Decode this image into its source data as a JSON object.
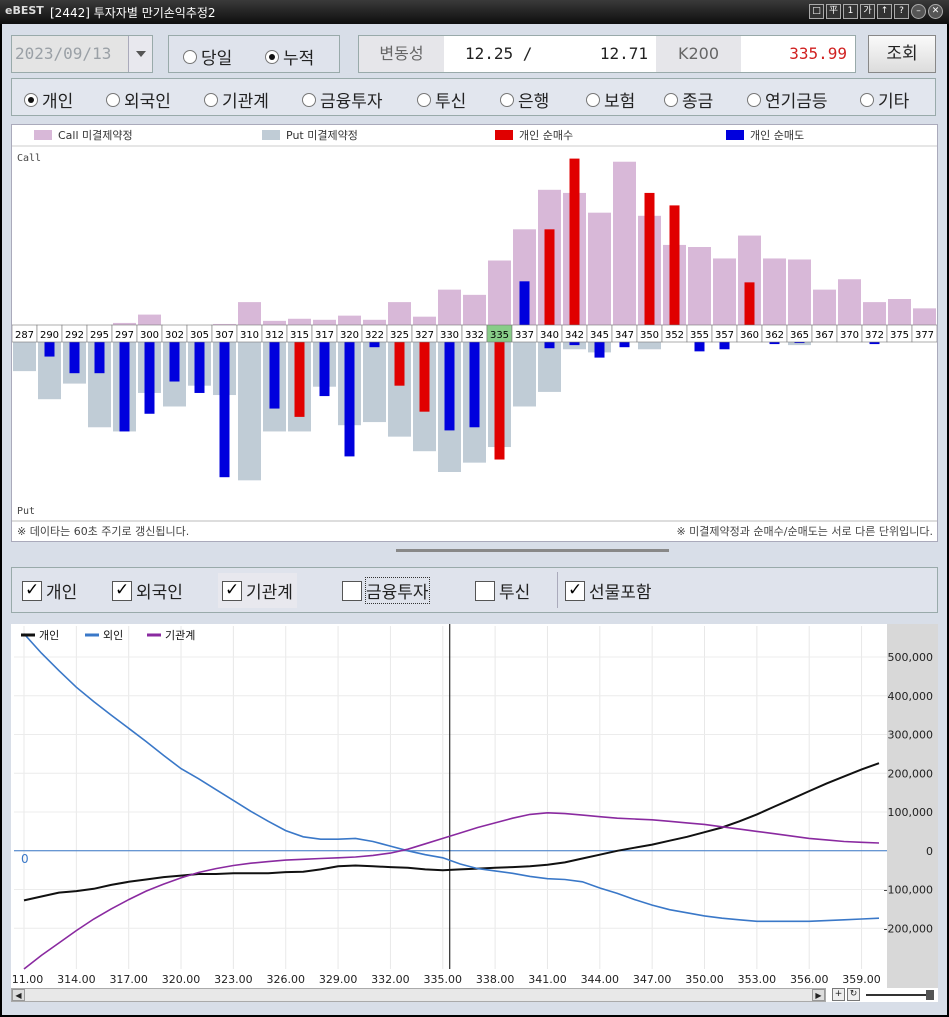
{
  "window": {
    "logo_text": "eBEST",
    "title": "[2442] 투자자별 만기손익추정2",
    "buttons": [
      "□",
      "平",
      "1",
      "가",
      "↑",
      "?",
      "–",
      "✕"
    ]
  },
  "controls": {
    "date": "2023/09/13",
    "mode_options": [
      {
        "label": "당일",
        "selected": false
      },
      {
        "label": "누적",
        "selected": true
      }
    ],
    "volatility_label": "변동성",
    "volatility_value": "12.25 /       12.71",
    "k200_label": "K200",
    "k200_value": "335.99",
    "query_button": "조회"
  },
  "investors": [
    {
      "label": "개인",
      "selected": true
    },
    {
      "label": "외국인",
      "selected": false
    },
    {
      "label": "기관계",
      "selected": false
    },
    {
      "label": "금융투자",
      "selected": false
    },
    {
      "label": "투신",
      "selected": false
    },
    {
      "label": "은행",
      "selected": false
    },
    {
      "label": "보험",
      "selected": false
    },
    {
      "label": "종금",
      "selected": false
    },
    {
      "label": "연기금등",
      "selected": false
    },
    {
      "label": "기타",
      "selected": false
    }
  ],
  "chart_data": [
    {
      "type": "bar",
      "legend": [
        "Call 미결제약정",
        "Put 미결제약정",
        "개인 순매수",
        "개인 순매도"
      ],
      "colors": {
        "call_oi": "#d8b8d8",
        "put_oi": "#c0ccd6",
        "buy": "#e00000",
        "sell": "#0000dd",
        "highlight": "#88cc88"
      },
      "call_label": "Call",
      "put_label": "Put",
      "strikes": [
        "287",
        "290",
        "292",
        "295",
        "297",
        "300",
        "302",
        "305",
        "307",
        "310",
        "312",
        "315",
        "317",
        "320",
        "322",
        "325",
        "327",
        "330",
        "332",
        "335",
        "337",
        "340",
        "342",
        "345",
        "347",
        "350",
        "352",
        "355",
        "357",
        "360",
        "362",
        "365",
        "367",
        "370",
        "372",
        "375",
        "377"
      ],
      "atm_strike": "335",
      "call_oi": [
        0,
        0,
        0,
        0,
        2,
        10,
        0,
        0,
        1,
        22,
        4,
        6,
        5,
        9,
        5,
        22,
        8,
        34,
        29,
        62,
        92,
        130,
        127,
        108,
        157,
        105,
        77,
        75,
        64,
        86,
        64,
        63,
        34,
        44,
        22,
        25,
        16
      ],
      "put_oi": [
        -28,
        -55,
        -40,
        -82,
        -86,
        -49,
        -62,
        -42,
        -51,
        -133,
        -86,
        -86,
        -43,
        -80,
        -77,
        -91,
        -105,
        -125,
        -116,
        -101,
        -62,
        -48,
        -7,
        -10,
        0,
        -7,
        0,
        0,
        0,
        0,
        0,
        -3,
        0,
        0,
        0,
        0,
        0
      ],
      "individual_net_buy": [
        0,
        0,
        0,
        0,
        0,
        0,
        0,
        0,
        0,
        0,
        0,
        -72,
        0,
        0,
        0,
        -42,
        -67,
        0,
        0,
        -113,
        0,
        92,
        160,
        0,
        0,
        127,
        115,
        0,
        0,
        41,
        0,
        0,
        0,
        0,
        0,
        0,
        0
      ],
      "individual_net_sell": [
        0,
        -14,
        -30,
        -30,
        -86,
        -69,
        -38,
        -49,
        -130,
        0,
        -64,
        0,
        -52,
        -110,
        -5,
        0,
        0,
        -85,
        -82,
        0,
        42,
        -6,
        -3,
        -15,
        -5,
        0,
        0,
        -9,
        -7,
        0,
        -2,
        -1,
        0,
        0,
        -2,
        0,
        0
      ],
      "notes": [
        "※ 데이타는 60초 주기로 갱신됩니다.",
        "※ 미결제약정과 순매수/순매도는 서로 다른 단위입니다."
      ]
    },
    {
      "type": "line",
      "x": [
        311,
        312,
        313,
        314,
        315,
        316,
        317,
        318,
        319,
        320,
        321,
        322,
        323,
        324,
        325,
        326,
        327,
        328,
        329,
        330,
        331,
        332,
        333,
        334,
        335,
        336,
        337,
        338,
        339,
        340,
        341,
        342,
        343,
        344,
        345,
        346,
        347,
        348,
        349,
        350,
        351,
        352,
        353,
        354,
        355,
        356,
        357,
        358,
        359,
        360
      ],
      "x_ticks": [
        "311.00",
        "314.00",
        "317.00",
        "320.00",
        "323.00",
        "326.00",
        "329.00",
        "332.00",
        "335.00",
        "338.00",
        "341.00",
        "344.00",
        "347.00",
        "350.00",
        "353.00",
        "356.00",
        "359.00"
      ],
      "y_ticks": [
        "500,000",
        "400,000",
        "300,000",
        "200,000",
        "100,000",
        "0",
        "-100,000",
        "-200,000"
      ],
      "ylim": [
        -305000,
        580000
      ],
      "zero_label": "0",
      "cursor_x": 335.4,
      "series": [
        {
          "name": "개인",
          "color": "#111111",
          "values": [
            -128000,
            -118000,
            -108000,
            -104000,
            -98000,
            -88000,
            -80000,
            -74000,
            -68000,
            -64000,
            -60000,
            -60000,
            -58000,
            -58000,
            -58000,
            -55000,
            -54000,
            -48000,
            -40000,
            -38000,
            -40000,
            -42000,
            -44000,
            -48000,
            -50000,
            -48000,
            -46000,
            -44000,
            -42000,
            -40000,
            -36000,
            -30000,
            -20000,
            -10000,
            0,
            8000,
            16000,
            26000,
            36000,
            48000,
            60000,
            76000,
            94000,
            114000,
            134000,
            154000,
            174000,
            192000,
            210000,
            226000
          ]
        },
        {
          "name": "외인",
          "color": "#3a78c8",
          "values": [
            560000,
            510000,
            465000,
            422000,
            385000,
            350000,
            316000,
            282000,
            246000,
            212000,
            186000,
            158000,
            130000,
            102000,
            76000,
            52000,
            36000,
            30000,
            30000,
            32000,
            24000,
            12000,
            0,
            -10000,
            -18000,
            -34000,
            -46000,
            -52000,
            -58000,
            -66000,
            -72000,
            -74000,
            -80000,
            -96000,
            -110000,
            -126000,
            -140000,
            -152000,
            -160000,
            -168000,
            -174000,
            -178000,
            -182000,
            -182000,
            -182000,
            -182000,
            -180000,
            -178000,
            -176000,
            -174000
          ]
        },
        {
          "name": "기관계",
          "color": "#8a2aa0",
          "values": [
            -305000,
            -270000,
            -238000,
            -206000,
            -176000,
            -150000,
            -126000,
            -104000,
            -86000,
            -70000,
            -56000,
            -46000,
            -38000,
            -32000,
            -28000,
            -24000,
            -22000,
            -20000,
            -18000,
            -16000,
            -12000,
            -6000,
            4000,
            18000,
            32000,
            46000,
            60000,
            72000,
            84000,
            94000,
            98000,
            96000,
            92000,
            88000,
            84000,
            82000,
            80000,
            76000,
            72000,
            68000,
            62000,
            56000,
            50000,
            44000,
            38000,
            32000,
            28000,
            24000,
            22000,
            20000
          ]
        }
      ]
    }
  ],
  "toggles": [
    {
      "label": "개인",
      "checked": true
    },
    {
      "label": "외국인",
      "checked": true
    },
    {
      "label": "기관계",
      "checked": true
    },
    {
      "label": "금융투자",
      "checked": false
    },
    {
      "label": "투신",
      "checked": false
    },
    {
      "label": "선물포함",
      "checked": true
    }
  ]
}
